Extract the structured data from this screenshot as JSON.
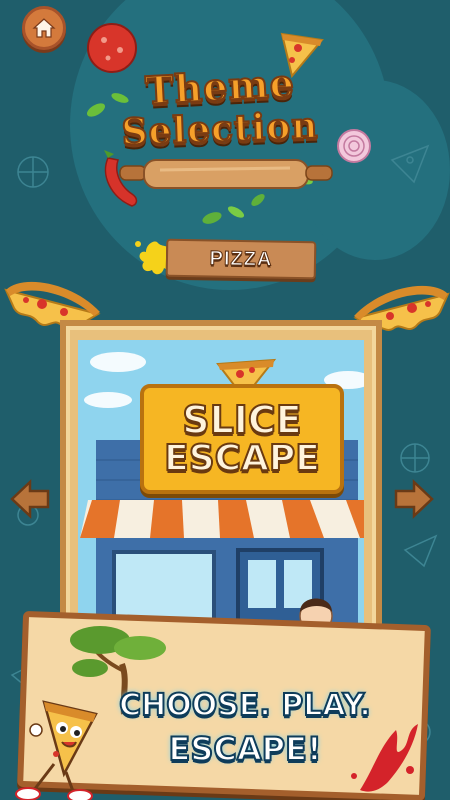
{
  "header": {
    "home_icon": "home-icon",
    "title_line1": "Theme",
    "title_line2": "Selection"
  },
  "theme_selector": {
    "current_theme": "PIZZA",
    "prev_icon": "arrow-left-icon",
    "next_icon": "arrow-right-icon"
  },
  "preview": {
    "game_title_line1": "SLICE",
    "game_title_line2": "ESCAPE"
  },
  "banner": {
    "line1": "CHOOSE. PLAY.",
    "line2": "ESCAPE!"
  },
  "colors": {
    "background": "#1f5e6b",
    "title_orange": "#f6a02a",
    "wood": "#c98a55",
    "logo_yellow": "#f6b623",
    "banner_text": "#ffffff",
    "banner_outline": "#0e3c5a"
  }
}
